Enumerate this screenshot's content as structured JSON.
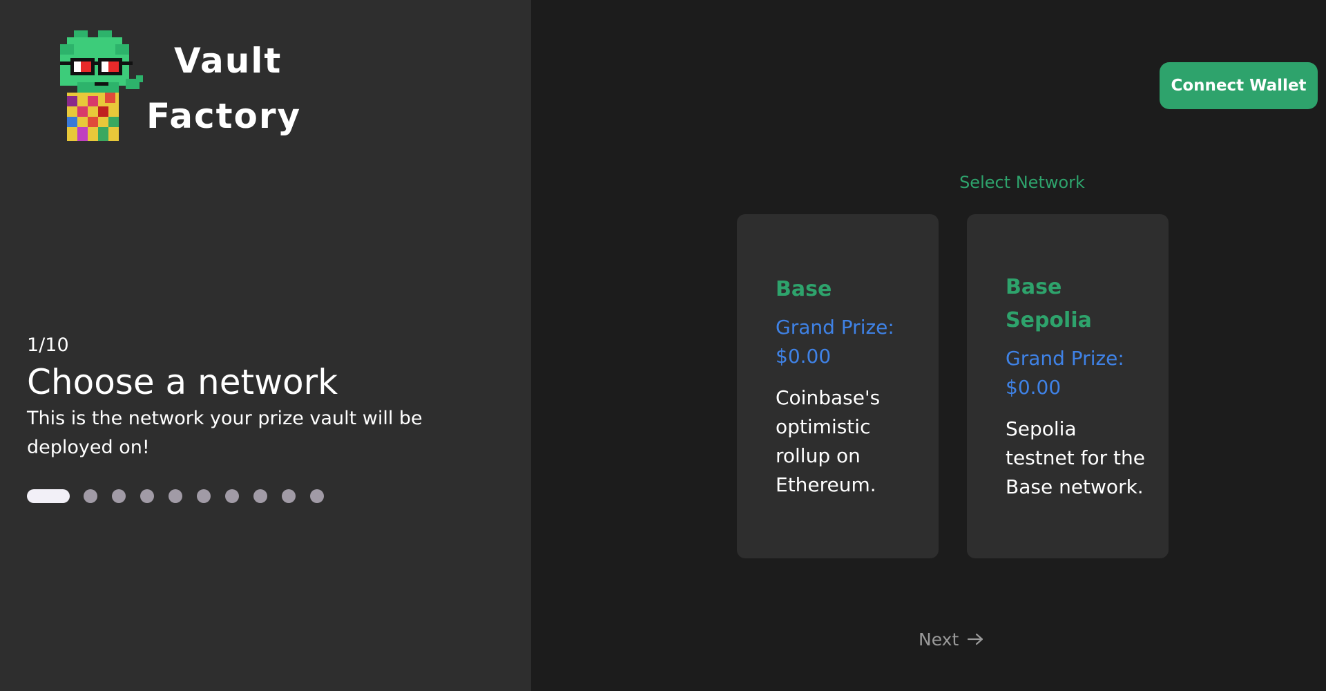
{
  "logo": {
    "line1": "Vault",
    "line2": "Factory"
  },
  "header": {
    "connect_label": "Connect Wallet"
  },
  "intro": {
    "step": "1/10",
    "title": "Choose a network",
    "description": "This is the network your prize vault will be deployed on!"
  },
  "progress": {
    "current": 1,
    "total": 10
  },
  "network": {
    "label": "Select Network",
    "cards": [
      {
        "name": "Base",
        "prize": "Grand Prize: $0.00",
        "description": "Coinbase's optimistic rollup on Ethereum."
      },
      {
        "name": "Base Sepolia",
        "prize": "Grand Prize: $0.00",
        "description": "Sepolia testnet for the Base network."
      }
    ]
  },
  "footer": {
    "next_label": "Next"
  },
  "colors": {
    "accent_green": "#2ea36c",
    "prize_blue": "#3f82e6",
    "panel_dark": "#2e2e2e",
    "background": "#1c1c1c"
  }
}
